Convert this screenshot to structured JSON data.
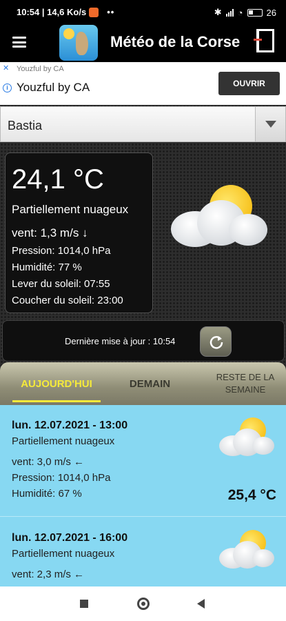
{
  "status_bar": {
    "time_speed": "10:54 | 14,6 Ko/s",
    "dots": "••",
    "battery": "26"
  },
  "app_bar": {
    "title": "Météo de la Corse"
  },
  "ad": {
    "advertiser": "Youzful by CA",
    "title": "Youzful by CA",
    "button": "OUVRIR"
  },
  "city": {
    "selected": "Bastia"
  },
  "current": {
    "temperature": "24,1 °C",
    "description": "Partiellement nuageux",
    "wind": "vent: 1,3 m/s ↓",
    "pressure": "Pression: 1014,0 hPa",
    "humidity": "Humidité: 77 %",
    "sunrise": "Lever du soleil: 07:55",
    "sunset": "Coucher du soleil: 23:00",
    "icon": "partly-cloudy-icon"
  },
  "update": {
    "label": "Dernière mise à jour : 10:54"
  },
  "tabs": {
    "today": "AUJOURD'HUI",
    "tomorrow": "DEMAIN",
    "rest": "RESTE DE LA SEMAINE"
  },
  "forecasts": [
    {
      "date": "lun. 12.07.2021 - 13:00",
      "description": "Partiellement nuageux",
      "wind": "vent: 3,0 m/s ←",
      "pressure": "Pression: 1014,0 hPa",
      "humidity": "Humidité: 67 %",
      "temperature": "25,4 °C"
    },
    {
      "date": "lun. 12.07.2021 - 16:00",
      "description": "Partiellement nuageux",
      "wind": "vent: 2,3 m/s ←"
    }
  ],
  "colors": {
    "accent_tab": "#f5ea3a",
    "forecast_bg": "#87d8f2",
    "ad_blue": "#2a7be4"
  }
}
